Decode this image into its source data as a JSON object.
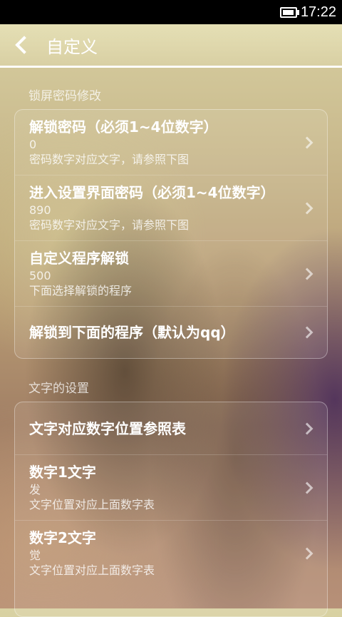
{
  "status_bar": {
    "time": "17:22"
  },
  "header": {
    "title": "自定义"
  },
  "section1": {
    "title": "锁屏密码修改",
    "items": [
      {
        "title": "解锁密码（必须1~4位数字）",
        "value": "0",
        "desc": "密码数字对应文字，请参照下图"
      },
      {
        "title": "进入设置界面密码（必须1~4位数字）",
        "value": "890",
        "desc": "密码数字对应文字，请参照下图"
      },
      {
        "title": "自定义程序解锁",
        "value": "500",
        "desc": "下面选择解锁的程序"
      },
      {
        "title": "解锁到下面的程序（默认为qq）"
      }
    ]
  },
  "section2": {
    "title": "文字的设置",
    "items": [
      {
        "title": "文字对应数字位置参照表"
      },
      {
        "title": "数字1文字",
        "value": "发",
        "desc": "文字位置对应上面数字表"
      },
      {
        "title": "数字2文字",
        "value": "觉",
        "desc": "文字位置对应上面数字表"
      }
    ]
  }
}
